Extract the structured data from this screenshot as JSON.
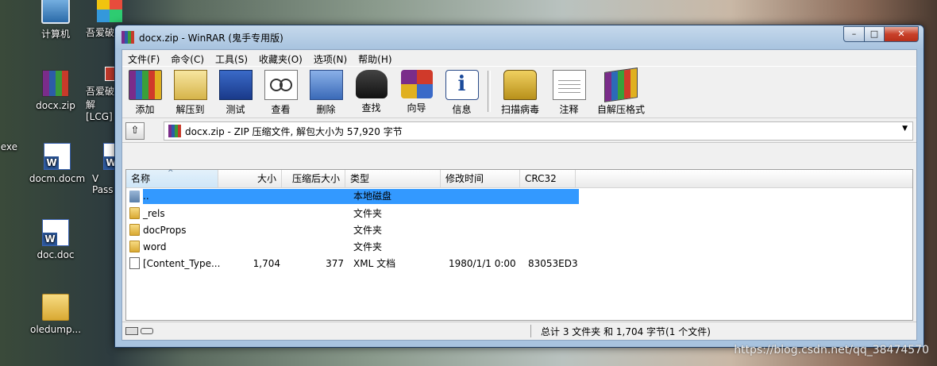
{
  "desktop": {
    "icons": [
      {
        "label": "计算机",
        "icon": "computer-icon"
      },
      {
        "label": "吾爱破解工具",
        "icon": "toolkit-icon"
      },
      {
        "label": "docx.zip",
        "icon": "winrar-archive-icon"
      },
      {
        "label": "吾爱破解[LCG]",
        "icon": "crack-tool-icon"
      },
      {
        "label": "exe",
        "icon": "file-icon"
      },
      {
        "label": "docm.docm",
        "icon": "word-doc-icon"
      },
      {
        "label": "V Pass",
        "icon": "word-doc-icon"
      },
      {
        "label": "doc.doc",
        "icon": "word-doc-icon"
      },
      {
        "label": "oledump...",
        "icon": "folder-icon"
      }
    ]
  },
  "window": {
    "title": "docx.zip - WinRAR (鬼手专用版)",
    "caption_buttons": {
      "minimize": "–",
      "maximize": "□",
      "close": "✕"
    }
  },
  "menu": [
    "文件(F)",
    "命令(C)",
    "工具(S)",
    "收藏夹(O)",
    "选项(N)",
    "帮助(H)"
  ],
  "toolbar": [
    {
      "label": "添加",
      "icon": "add-archive-icon"
    },
    {
      "label": "解压到",
      "icon": "extract-to-icon"
    },
    {
      "label": "测试",
      "icon": "test-icon"
    },
    {
      "label": "查看",
      "icon": "view-icon"
    },
    {
      "label": "删除",
      "icon": "delete-icon"
    },
    {
      "label": "查找",
      "icon": "find-icon"
    },
    {
      "label": "向导",
      "icon": "wizard-icon"
    },
    {
      "label": "信息",
      "icon": "info-icon"
    },
    {
      "label": "扫描病毒",
      "icon": "virus-scan-icon"
    },
    {
      "label": "注释",
      "icon": "comment-icon"
    },
    {
      "label": "自解压格式",
      "icon": "sfx-icon"
    }
  ],
  "address": {
    "up_button": "⇧",
    "path": "docx.zip - ZIP 压缩文件, 解包大小为 57,920 字节",
    "dropdown": "▼"
  },
  "columns": {
    "name": "名称",
    "size": "大小",
    "packed": "压缩后大小",
    "type": "类型",
    "modified": "修改时间",
    "crc": "CRC32"
  },
  "rows": [
    {
      "name": "..",
      "size": "",
      "packed": "",
      "type": "本地磁盘",
      "modified": "",
      "crc": "",
      "icon": "up-folder-icon"
    },
    {
      "name": "_rels",
      "size": "",
      "packed": "",
      "type": "文件夹",
      "modified": "",
      "crc": "",
      "icon": "folder-icon"
    },
    {
      "name": "docProps",
      "size": "",
      "packed": "",
      "type": "文件夹",
      "modified": "",
      "crc": "",
      "icon": "folder-icon"
    },
    {
      "name": "word",
      "size": "",
      "packed": "",
      "type": "文件夹",
      "modified": "",
      "crc": "",
      "icon": "folder-icon"
    },
    {
      "name": "[Content_Type...",
      "size": "1,704",
      "packed": "377",
      "type": "XML 文档",
      "modified": "1980/1/1 0:00",
      "crc": "83053ED3",
      "icon": "xml-file-icon"
    }
  ],
  "status": {
    "summary": "总计 3 文件夹 和 1,704 字节(1 个文件)"
  },
  "watermark": "https://blog.csdn.net/qq_38474570"
}
